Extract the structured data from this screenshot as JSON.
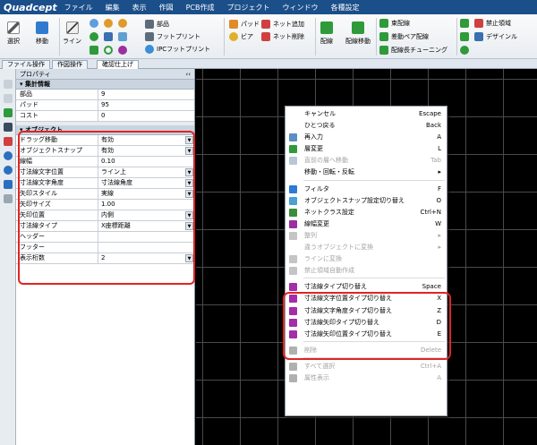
{
  "app": {
    "logo": "Quadcept"
  },
  "menus": [
    "ファイル",
    "編集",
    "表示",
    "作図",
    "PCB作成",
    "プロジェクト",
    "ウィンドウ",
    "各種設定"
  ],
  "ribbon": {
    "select": "選択",
    "move": "移動",
    "line": "ライン",
    "part": "部品",
    "footprint": "フットプリント",
    "ipc_footprint": "IPCフットプリント",
    "pad": "パッド",
    "via": "ビア",
    "net_add": "ネット追加",
    "net_delete": "ネット削除",
    "route": "配線",
    "route_move": "配線移動",
    "interactive_route": "束配線",
    "diff_pair": "差動ペア配線",
    "length_tuning": "配線長チューニング",
    "keepout": "禁止領域",
    "design_rule": "デザインル"
  },
  "tabs": [
    "ファイル操作",
    "作図操作",
    "確認仕上げ"
  ],
  "panel": {
    "title": "プロパティ",
    "close": "‹‹",
    "summary": {
      "title": "集計情報",
      "rows": [
        {
          "k": "部品",
          "v": "9"
        },
        {
          "k": "パッド",
          "v": "95"
        },
        {
          "k": "コスト",
          "v": "0"
        }
      ]
    },
    "object": {
      "title": "オブジェクト",
      "rows": [
        {
          "k": "ドラッグ移動",
          "v": "有効",
          "dd": true
        },
        {
          "k": "オブジェクトスナップ",
          "v": "有効",
          "dd": true
        },
        {
          "k": "線幅",
          "v": "0.10",
          "dd": false
        },
        {
          "k": "寸法線文字位置",
          "v": "ライン上",
          "dd": true
        },
        {
          "k": "寸法線文字角度",
          "v": "寸法線角度",
          "dd": true
        },
        {
          "k": "矢印スタイル",
          "v": "実線",
          "dd": true
        },
        {
          "k": "矢印サイズ",
          "v": "1.00",
          "dd": false
        },
        {
          "k": "矢印位置",
          "v": "内側",
          "dd": true
        },
        {
          "k": "寸法線タイプ",
          "v": "X座標距離",
          "dd": true
        },
        {
          "k": "ヘッダー",
          "v": "",
          "dd": false
        },
        {
          "k": "フッター",
          "v": "",
          "dd": false
        },
        {
          "k": "表示桁数",
          "v": "2",
          "dd": true
        }
      ]
    }
  },
  "context_menu": {
    "items": [
      {
        "type": "item",
        "label": "キャンセル",
        "shortcut": "Escape",
        "icon": "",
        "disabled": false,
        "arrow": false
      },
      {
        "type": "item",
        "label": "ひとつ戻る",
        "shortcut": "Back",
        "icon": "",
        "disabled": false,
        "arrow": false
      },
      {
        "type": "item",
        "label": "再入力",
        "shortcut": "A",
        "icon": "#5a8fc4",
        "disabled": false,
        "arrow": false
      },
      {
        "type": "item",
        "label": "層変更",
        "shortcut": "L",
        "icon": "#2f9a3a",
        "disabled": false,
        "arrow": false
      },
      {
        "type": "item",
        "label": "直前の層へ移動",
        "shortcut": "Tab",
        "icon": "#b7c7d6",
        "disabled": true,
        "arrow": false
      },
      {
        "type": "item",
        "label": "移動・回転・反転",
        "shortcut": "",
        "icon": "",
        "disabled": false,
        "arrow": true
      },
      {
        "type": "sep"
      },
      {
        "type": "item",
        "label": "フィルタ",
        "shortcut": "F",
        "icon": "#2c7bd6",
        "disabled": false,
        "arrow": false
      },
      {
        "type": "item",
        "label": "オブジェクトスナップ設定切り替え",
        "shortcut": "O",
        "icon": "#4a9fd4",
        "disabled": false,
        "arrow": false
      },
      {
        "type": "item",
        "label": "ネットクラス設定",
        "shortcut": "Ctrl+N",
        "icon": "#3a8e3a",
        "disabled": false,
        "arrow": false
      },
      {
        "type": "item",
        "label": "線幅変更",
        "shortcut": "W",
        "icon": "#9c2fa0",
        "disabled": false,
        "arrow": false
      },
      {
        "type": "item",
        "label": "整列",
        "shortcut": "",
        "icon": "#c4c4c4",
        "disabled": true,
        "arrow": true
      },
      {
        "type": "item",
        "label": "違うオブジェクトに変換",
        "shortcut": "",
        "icon": "",
        "disabled": true,
        "arrow": true
      },
      {
        "type": "item",
        "label": "ラインに変換",
        "shortcut": "",
        "icon": "#c4c4c4",
        "disabled": true,
        "arrow": false
      },
      {
        "type": "item",
        "label": "禁止領域自動作成",
        "shortcut": "",
        "icon": "#c4c4c4",
        "disabled": true,
        "arrow": false
      },
      {
        "type": "sep"
      },
      {
        "type": "item",
        "label": "寸法線タイプ切り替え",
        "shortcut": "Space",
        "icon": "#a32ea8",
        "disabled": false,
        "arrow": false
      },
      {
        "type": "item",
        "label": "寸法線文字位置タイプ切り替え",
        "shortcut": "X",
        "icon": "#a32ea8",
        "disabled": false,
        "arrow": false
      },
      {
        "type": "item",
        "label": "寸法線文字角度タイプ切り替え",
        "shortcut": "Z",
        "icon": "#a32ea8",
        "disabled": false,
        "arrow": false
      },
      {
        "type": "item",
        "label": "寸法線矢印タイプ切り替え",
        "shortcut": "D",
        "icon": "#a32ea8",
        "disabled": false,
        "arrow": false
      },
      {
        "type": "item",
        "label": "寸法線矢印位置タイプ切り替え",
        "shortcut": "E",
        "icon": "#a32ea8",
        "disabled": false,
        "arrow": false
      },
      {
        "type": "sep"
      },
      {
        "type": "item",
        "label": "削除",
        "shortcut": "Delete",
        "icon": "#b0b0b0",
        "disabled": true,
        "arrow": false
      },
      {
        "type": "sep"
      },
      {
        "type": "item",
        "label": "すべて選択",
        "shortcut": "Ctrl+A",
        "icon": "#b0b0b0",
        "disabled": true,
        "arrow": false
      },
      {
        "type": "item",
        "label": "属性表示",
        "shortcut": "A",
        "icon": "#b0b0b0",
        "disabled": true,
        "arrow": false
      }
    ]
  }
}
